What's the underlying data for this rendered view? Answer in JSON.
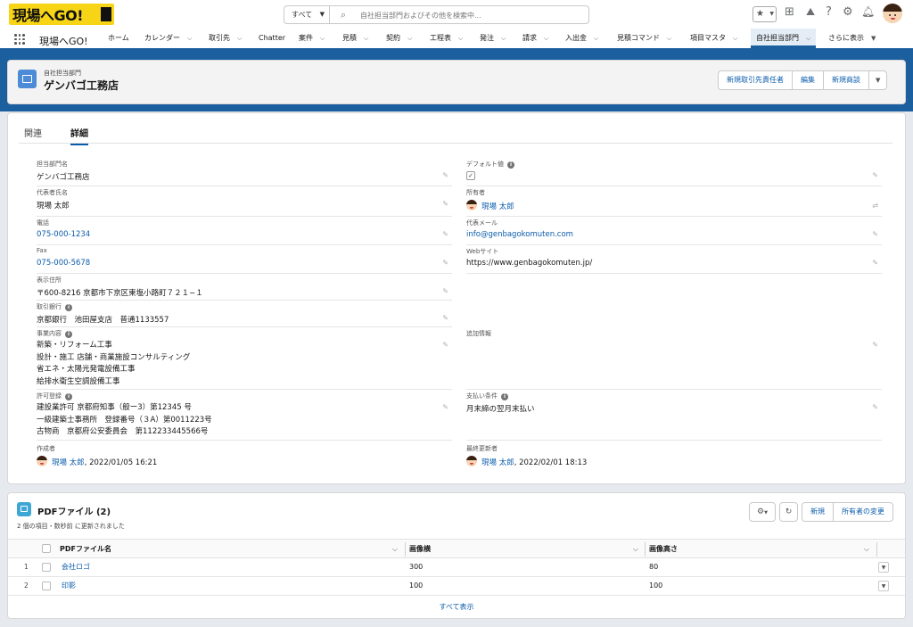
{
  "app": {
    "logo_text": "現場へGO!",
    "name": "現場へGO!"
  },
  "search": {
    "scope": "すべて",
    "placeholder": "自社担当部門およびその他を検索中..."
  },
  "nav": {
    "items": [
      {
        "label": "ホーム",
        "chevron": false
      },
      {
        "label": "カレンダー",
        "chevron": true
      },
      {
        "label": "取引先",
        "chevron": true
      },
      {
        "label": "Chatter",
        "chevron": false
      },
      {
        "label": "案件",
        "chevron": true
      },
      {
        "label": "見積",
        "chevron": true
      },
      {
        "label": "契約",
        "chevron": true
      },
      {
        "label": "工程表",
        "chevron": true
      },
      {
        "label": "発注",
        "chevron": true
      },
      {
        "label": "請求",
        "chevron": true
      },
      {
        "label": "入出金",
        "chevron": true
      },
      {
        "label": "見積コマンド",
        "chevron": true
      },
      {
        "label": "項目マスタ",
        "chevron": true
      },
      {
        "label": "自社担当部門",
        "chevron": true
      },
      {
        "label": "さらに表示",
        "chevron": true
      }
    ]
  },
  "record": {
    "object_label": "自社担当部門",
    "name": "ゲンバゴ工務店",
    "actions": [
      "新規取引先責任者",
      "編集",
      "新規商談"
    ]
  },
  "tabs": {
    "related": "関連",
    "detail": "詳細"
  },
  "fields": {
    "dept_name": {
      "label": "担当部門名",
      "value": "ゲンバゴ工務店"
    },
    "default_value": {
      "label": "デフォルト値",
      "checked": "✓"
    },
    "rep_name": {
      "label": "代表者氏名",
      "value": "現場 太郎"
    },
    "owner": {
      "label": "所有者",
      "value": "現場 太郎"
    },
    "phone": {
      "label": "電話",
      "value": "075-000-1234"
    },
    "email": {
      "label": "代表メール",
      "value": "info@genbagokomuten.com"
    },
    "fax": {
      "label": "Fax",
      "value": "075-000-5678"
    },
    "website": {
      "label": "Webサイト",
      "value": "https://www.genbagokomuten.jp/"
    },
    "address": {
      "label": "表示住所",
      "value": "〒600-8216 京都市下京区東塩小路町７２１−１"
    },
    "bank": {
      "label": "取引銀行",
      "value": "京都銀行　池田屋支店　普通1133557"
    },
    "business": {
      "label": "事業内容",
      "lines": [
        "新築・リフォーム工事",
        "設計・施工 店舗・商業施設コンサルティング",
        "省エネ・太陽光発電設備工事",
        "給排水衛生空調設備工事"
      ]
    },
    "additional": {
      "label": "追加情報",
      "value": ""
    },
    "license": {
      "label": "許可登録",
      "lines": [
        "建設業許可 京都府知事（般ー3）第12345 号",
        "一級建築士事務所　登録番号（３A）第0011223号",
        "古物商　京都府公安委員会　第112233445566号"
      ]
    },
    "payment": {
      "label": "支払い条件",
      "value": "月末締の翌月末払い"
    },
    "created_by": {
      "label": "作成者",
      "user": "現場 太郎",
      "datetime": ", 2022/01/05 16:21"
    },
    "modified_by": {
      "label": "最終更新者",
      "user": "現場 太郎",
      "datetime": ", 2022/02/01 18:13"
    }
  },
  "related_list": {
    "title": "PDFファイル (2)",
    "meta": "2 個の項目・数秒前 に更新されました",
    "actions": [
      "新規",
      "所有者の変更"
    ],
    "columns": [
      "PDFファイル名",
      "画像横",
      "画像高さ"
    ],
    "rows": [
      {
        "num": "1",
        "name": "会社ロゴ",
        "width": "300",
        "height": "80"
      },
      {
        "num": "2",
        "name": "印影",
        "width": "100",
        "height": "100"
      }
    ],
    "view_all": "すべて表示"
  }
}
